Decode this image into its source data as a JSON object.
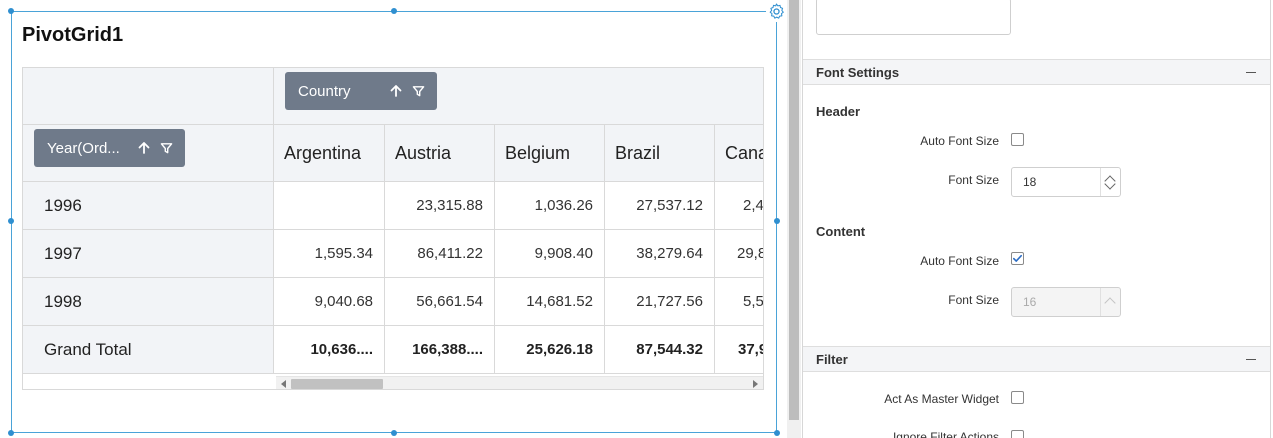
{
  "widget": {
    "title": "PivotGrid1"
  },
  "pivot": {
    "column_field": "Country",
    "row_field": "Year(Ord...",
    "columns": [
      "Argentina",
      "Austria",
      "Belgium",
      "Brazil",
      "Cana"
    ],
    "rows": [
      {
        "label": "1996",
        "values": [
          "",
          "23,315.88",
          "1,036.26",
          "27,537.12",
          "2,4"
        ]
      },
      {
        "label": "1997",
        "values": [
          "1,595.34",
          "86,411.22",
          "9,908.40",
          "38,279.64",
          "29,8"
        ]
      },
      {
        "label": "1998",
        "values": [
          "9,040.68",
          "56,661.54",
          "14,681.52",
          "21,727.56",
          "5,5"
        ]
      }
    ],
    "grand_total": {
      "label": "Grand Total",
      "values": [
        "10,636....",
        "166,388....",
        "25,626.18",
        "87,544.32",
        "37,9"
      ]
    }
  },
  "panel": {
    "font_settings": {
      "title": "Font Settings",
      "header": {
        "title": "Header",
        "auto_font_size_label": "Auto Font Size",
        "auto_font_size_checked": false,
        "font_size_label": "Font Size",
        "font_size_value": "18"
      },
      "content": {
        "title": "Content",
        "auto_font_size_label": "Auto Font Size",
        "auto_font_size_checked": true,
        "font_size_label": "Font Size",
        "font_size_value": "16"
      }
    },
    "filter": {
      "title": "Filter",
      "act_as_master_label": "Act As Master Widget",
      "ignore_filter_label": "Ignore Filter Actions"
    }
  },
  "colors": {
    "selection_border": "#4aa3d8",
    "chip_bg": "#6f7a8a",
    "checkbox_check": "#2b6cc4"
  }
}
